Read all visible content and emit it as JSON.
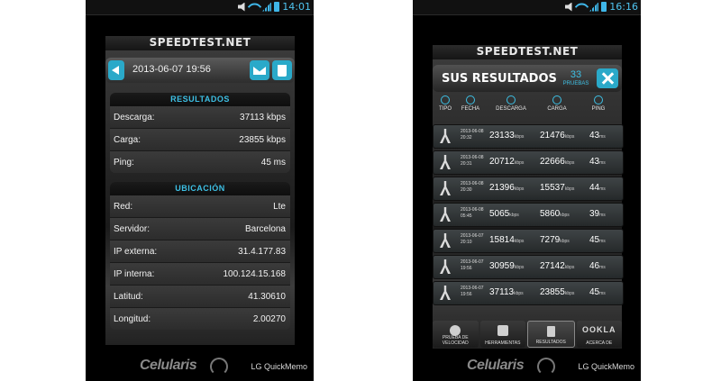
{
  "left": {
    "status_time": "14:01",
    "app_title": "SPEEDTEST.NET",
    "date": "2013-06-07 19:56",
    "results_header": "RESULTADOS",
    "results": [
      {
        "label": "Descarga:",
        "value": "37113 kbps"
      },
      {
        "label": "Carga:",
        "value": "23855 kbps"
      },
      {
        "label": "Ping:",
        "value": "45 ms"
      }
    ],
    "location_header": "UBICACIÓN",
    "location": [
      {
        "label": "Red:",
        "value": "Lte"
      },
      {
        "label": "Servidor:",
        "value": "Barcelona"
      },
      {
        "label": "IP externa:",
        "value": "31.4.177.83"
      },
      {
        "label": "IP interna:",
        "value": "100.124.15.168"
      },
      {
        "label": "Latitud:",
        "value": "41.30610"
      },
      {
        "label": "Longitud:",
        "value": "2.00270"
      }
    ],
    "watermark": "Celularis",
    "quickmemo": "LG QuickMemo"
  },
  "right": {
    "status_time": "16:16",
    "app_title": "SPEEDTEST.NET",
    "header_title": "SUS RESULTADOS",
    "count": "33",
    "count_label": "PRUEBAS",
    "columns": [
      "TIPO",
      "FECHA",
      "DESCARGA",
      "CARGA",
      "PING"
    ],
    "rows": [
      {
        "date": "2013-06-08",
        "time": "20:32",
        "down": "23133",
        "up": "21476",
        "ping": "43"
      },
      {
        "date": "2013-06-08",
        "time": "20:31",
        "down": "20712",
        "up": "22666",
        "ping": "43"
      },
      {
        "date": "2013-06-08",
        "time": "20:30",
        "down": "21396",
        "up": "15537",
        "ping": "44"
      },
      {
        "date": "2013-06-08",
        "time": "05:45",
        "down": "5065",
        "up": "5860",
        "ping": "39"
      },
      {
        "date": "2013-06-07",
        "time": "20:10",
        "down": "15814",
        "up": "7279",
        "ping": "45"
      },
      {
        "date": "2013-06-07",
        "time": "19:56",
        "down": "30959",
        "up": "27142",
        "ping": "46"
      },
      {
        "date": "2013-06-07",
        "time": "19:56",
        "down": "37113",
        "up": "23855",
        "ping": "45"
      }
    ],
    "unit_speed": "kbps",
    "unit_ping": "ms",
    "tabs": [
      "PRUEBA DE VELOCIDAD",
      "HERRAMIENTAS",
      "RESULTADOS",
      "ACERCA DE"
    ],
    "ookla": "OOKLA",
    "watermark": "Celularis",
    "quickmemo": "LG QuickMemo"
  },
  "colors": {
    "accent": "#2aa9c9",
    "header_text": "#3dc0e5"
  }
}
